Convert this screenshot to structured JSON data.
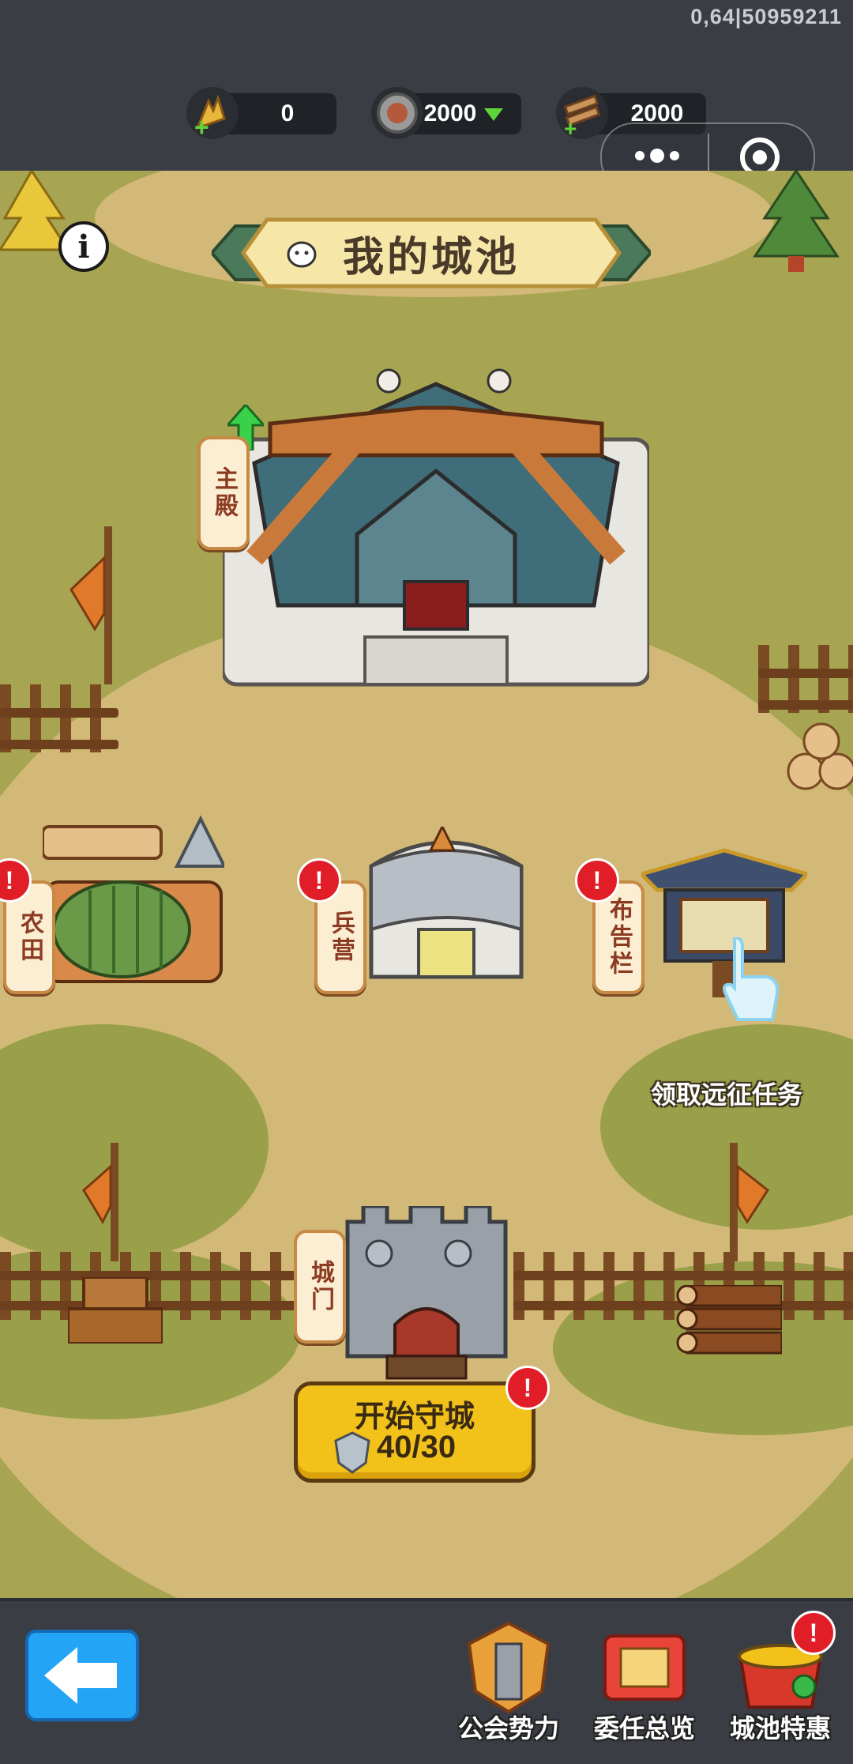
{
  "debug_id": "0,64|50959211",
  "resources": {
    "grain": "0",
    "coin": "2000",
    "wood": "2000"
  },
  "title": "我的城池",
  "buildings": {
    "main_hall": "主殿",
    "farm": "农田",
    "barracks": "兵营",
    "notice_board": "布告栏",
    "city_gate": "城门"
  },
  "task_label": "领取远征任务",
  "defend": {
    "title": "开始守城",
    "count": "40/30"
  },
  "nav": {
    "guild": "公会势力",
    "appoint": "委任总览",
    "offer": "城池特惠"
  },
  "alert_mark": "!",
  "colors": {
    "map_grass": "#a7a552",
    "dirt": "#d3b978",
    "button_yellow": "#f2c21a",
    "back_blue": "#23a4f5",
    "alert_red": "#e11d27"
  }
}
